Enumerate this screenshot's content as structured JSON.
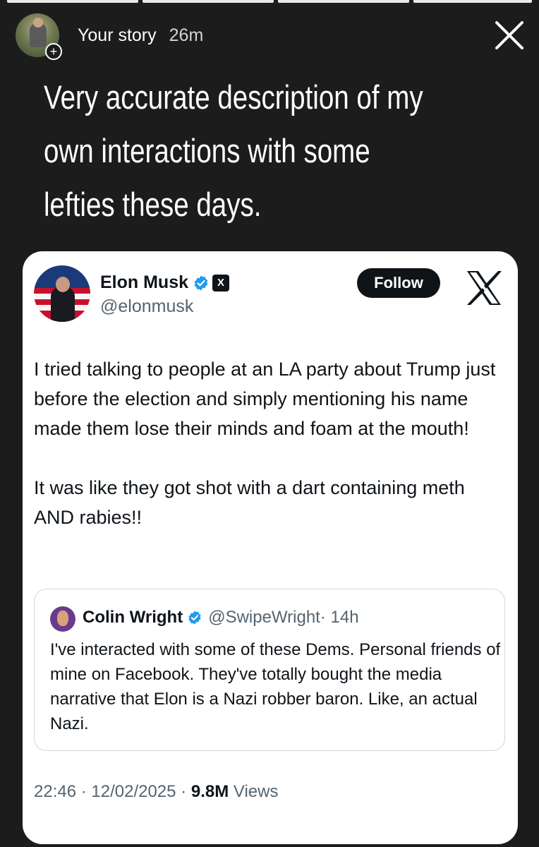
{
  "story": {
    "progress_segments": [
      {
        "state": "done"
      },
      {
        "state": "done"
      },
      {
        "state": "done"
      },
      {
        "state": "active"
      }
    ],
    "user": "Your story",
    "time": "26m",
    "caption_lines": [
      "Very accurate description of my",
      "own interactions with some",
      "lefties these days."
    ],
    "close_icon": "close-icon",
    "add_icon": "plus-icon"
  },
  "tweet": {
    "name": "Elon Musk",
    "handle": "@elonmusk",
    "follow_label": "Follow",
    "xbadge": "X",
    "verified_color": "#1d9bf0",
    "text_paragraphs": [
      "I tried talking to people at an LA party about Trump just before the election and simply mentioning his name made them lose their minds and foam at the mouth!",
      "It was like they got shot with a dart containing meth AND rabies!!"
    ],
    "quote": {
      "name": "Colin Wright",
      "handle": "@SwipeWright",
      "time": "· 14h",
      "text": "I've interacted with some of these Dems. Personal friends of mine on Facebook. They've totally bought the media narrative that Elon is a Nazi robber baron. Like, an actual Nazi."
    },
    "timestamp": "22:46 · 12/02/2025 ·",
    "views_count": "9.8M",
    "views_label": "Views"
  }
}
